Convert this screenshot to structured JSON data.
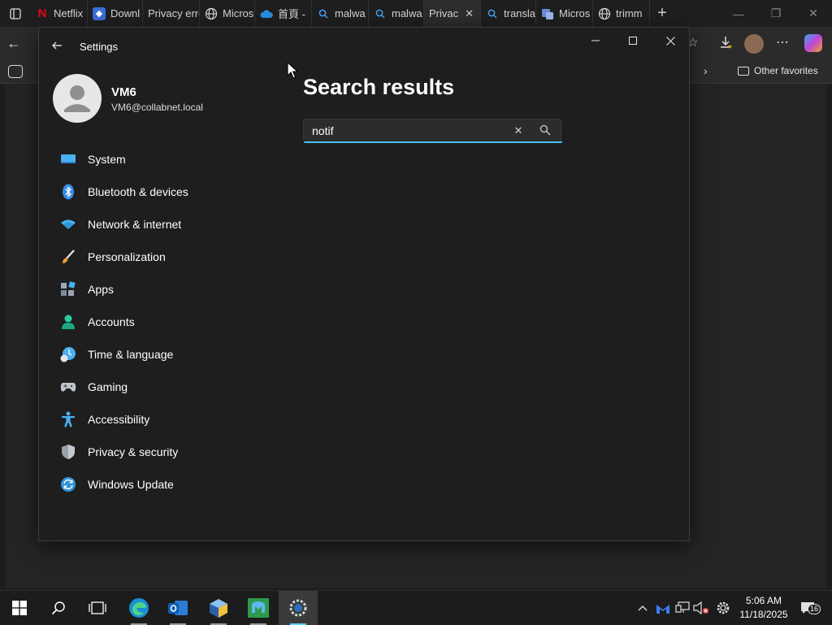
{
  "browser": {
    "tabs": [
      {
        "label": "Netflix",
        "icon": "netflix-icon"
      },
      {
        "label": "Downl",
        "icon": "download-page-icon"
      },
      {
        "label": "Privacy erro",
        "icon": "none"
      },
      {
        "label": "Micros",
        "icon": "globe-icon"
      },
      {
        "label": "首頁 -",
        "icon": "cloud-icon"
      },
      {
        "label": "malwa",
        "icon": "search-icon"
      },
      {
        "label": "malwa",
        "icon": "search-icon"
      },
      {
        "label": "Privac",
        "icon": "none",
        "active": true
      },
      {
        "label": "transla",
        "icon": "search-icon"
      },
      {
        "label": "Micros",
        "icon": "microsoft-icon"
      },
      {
        "label": "trimm",
        "icon": "globe-icon"
      }
    ],
    "favorites_label": "Other favorites"
  },
  "settings": {
    "app_title": "Settings",
    "profile": {
      "name": "VM6",
      "email": "VM6@collabnet.local"
    },
    "nav": [
      {
        "label": "System",
        "icon": "system-icon"
      },
      {
        "label": "Bluetooth & devices",
        "icon": "bluetooth-icon"
      },
      {
        "label": "Network & internet",
        "icon": "wifi-icon"
      },
      {
        "label": "Personalization",
        "icon": "brush-icon"
      },
      {
        "label": "Apps",
        "icon": "apps-icon"
      },
      {
        "label": "Accounts",
        "icon": "accounts-icon"
      },
      {
        "label": "Time & language",
        "icon": "time-language-icon"
      },
      {
        "label": "Gaming",
        "icon": "gaming-icon"
      },
      {
        "label": "Accessibility",
        "icon": "accessibility-icon"
      },
      {
        "label": "Privacy & security",
        "icon": "shield-icon"
      },
      {
        "label": "Windows Update",
        "icon": "windows-update-icon"
      }
    ],
    "heading": "Search results",
    "search": {
      "value": "notif",
      "placeholder": ""
    }
  },
  "taskbar": {
    "time": "5:06 AM",
    "date": "11/18/2025",
    "notification_count": "16"
  },
  "colors": {
    "accent": "#4cc2ff",
    "window_bg": "#1e1e1e"
  }
}
